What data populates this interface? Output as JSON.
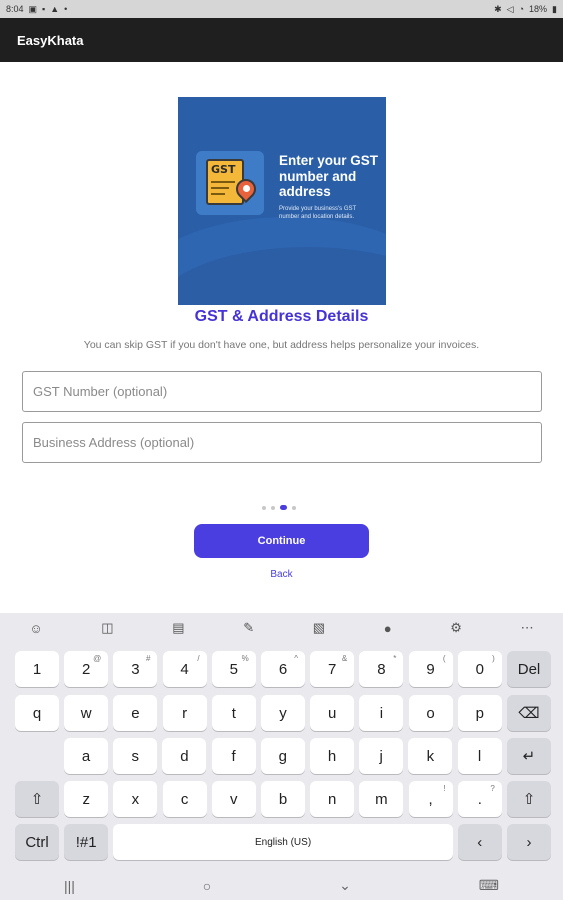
{
  "status_bar": {
    "time": "8:04",
    "left_icons": [
      "calendar-icon",
      "lock-icon",
      "photo-icon",
      "dot-icon"
    ],
    "right_icons": [
      "bluetooth-icon",
      "mute-icon",
      "wifi-icon",
      "battery-icon"
    ],
    "battery": "18%"
  },
  "app_bar": {
    "title": "EasyKhata"
  },
  "banner": {
    "icon_text": "GST",
    "headline": "Enter your GST number and address",
    "subtext": "Provide your business's GST number and location details."
  },
  "page": {
    "title": "GST & Address Details",
    "subtitle": "You can skip GST if you don't have one, but address helps personalize your invoices.",
    "gst_placeholder": "GST Number (optional)",
    "address_placeholder": "Business Address (optional)",
    "step_count": 4,
    "active_step": 3,
    "continue_label": "Continue",
    "back_label": "Back"
  },
  "keyboard": {
    "toolbar": [
      "emoji-icon",
      "sticker-icon",
      "gif-icon",
      "handwriting-icon",
      "translate-icon",
      "mic-icon",
      "settings-icon",
      "more-icon"
    ],
    "row1": [
      {
        "k": "1",
        "h": ""
      },
      {
        "k": "2",
        "h": "@"
      },
      {
        "k": "3",
        "h": "#"
      },
      {
        "k": "4",
        "h": "/"
      },
      {
        "k": "5",
        "h": "%"
      },
      {
        "k": "6",
        "h": "^"
      },
      {
        "k": "7",
        "h": "&"
      },
      {
        "k": "8",
        "h": "*"
      },
      {
        "k": "9",
        "h": "("
      },
      {
        "k": "0",
        "h": ")"
      }
    ],
    "del_label": "Del",
    "row2": [
      "q",
      "w",
      "e",
      "r",
      "t",
      "y",
      "u",
      "i",
      "o",
      "p"
    ],
    "row3": [
      "a",
      "s",
      "d",
      "f",
      "g",
      "h",
      "j",
      "k",
      "l"
    ],
    "row4": [
      {
        "k": "z",
        "h": ""
      },
      {
        "k": "x",
        "h": ""
      },
      {
        "k": "c",
        "h": ""
      },
      {
        "k": "v",
        "h": ""
      },
      {
        "k": "b",
        "h": ""
      },
      {
        "k": "n",
        "h": ""
      },
      {
        "k": "m",
        "h": ""
      },
      {
        "k": ",",
        "h": "!"
      },
      {
        "k": ".",
        "h": "?"
      }
    ],
    "ctrl_label": "Ctrl",
    "sym_label": "!#1",
    "space_label": "English (US)",
    "left_arrow": "‹",
    "right_arrow": "›"
  },
  "nav_bar": {
    "recents": "|||",
    "home": "○",
    "back": "⌄",
    "keyboard": "⌨"
  }
}
